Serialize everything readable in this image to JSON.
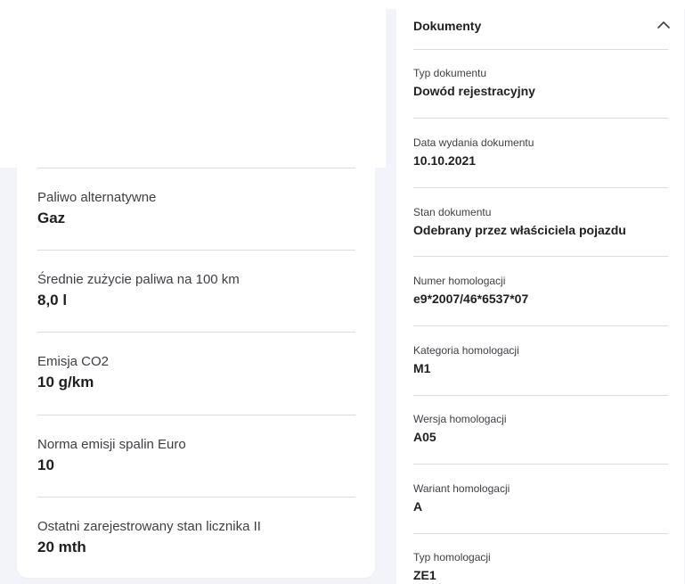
{
  "left_panel": {
    "items": [
      {
        "label": "Paliwo alternatywne",
        "value": "Gaz"
      },
      {
        "label": "Średnie zużycie paliwa na 100 km",
        "value": "8,0 l"
      },
      {
        "label": "Emisja CO2",
        "value": "10 g/km"
      },
      {
        "label": "Norma emisji spalin Euro",
        "value": "10"
      },
      {
        "label": "Ostatni zarejestrowany stan licznika II",
        "value": "20 mth"
      }
    ]
  },
  "documents_panel": {
    "title": "Dokumenty",
    "collapse_icon": "chevron-up-icon",
    "items": [
      {
        "label": "Typ dokumentu",
        "value": "Dowód rejestracyjny"
      },
      {
        "label": "Data wydania dokumentu",
        "value": "10.10.2021"
      },
      {
        "label": "Stan dokumentu",
        "value": "Odebrany przez właściciela pojazdu"
      },
      {
        "label": "Numer homologacji",
        "value": "e9*2007/46*6537*07"
      },
      {
        "label": "Kategoria homologacji",
        "value": "M1"
      },
      {
        "label": "Wersja homologacji",
        "value": "A05"
      },
      {
        "label": "Wariant homologacji",
        "value": "A"
      },
      {
        "label": "Typ homologacji",
        "value": "ZE1"
      }
    ]
  }
}
